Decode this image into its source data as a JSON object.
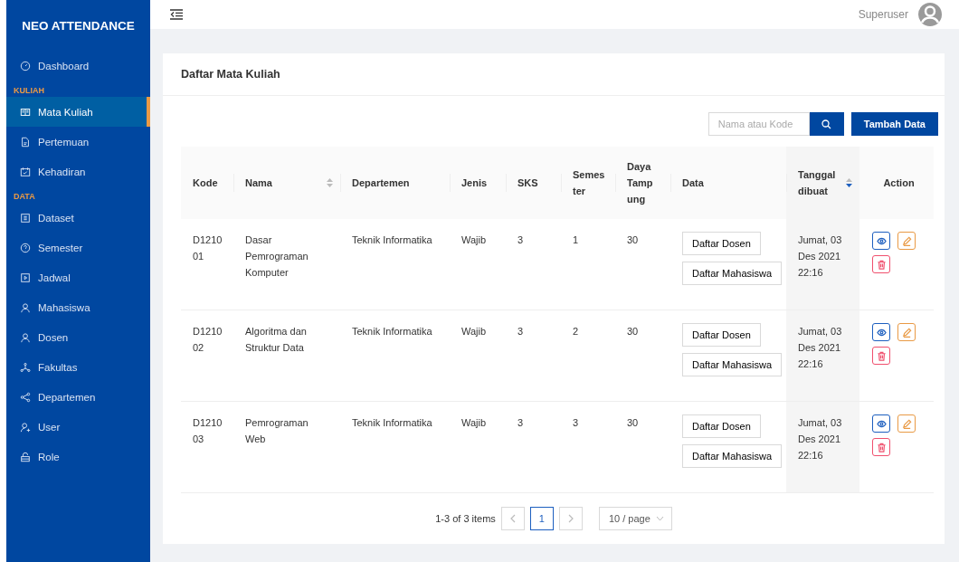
{
  "brand": "NEO ATTENDANCE",
  "nav": [
    {
      "kind": "item",
      "label": "Dashboard",
      "selected": false
    },
    {
      "kind": "section",
      "label": "KULIAH"
    },
    {
      "kind": "item",
      "label": "Mata Kuliah",
      "selected": true
    },
    {
      "kind": "item",
      "label": "Pertemuan",
      "selected": false
    },
    {
      "kind": "item",
      "label": "Kehadiran",
      "selected": false
    },
    {
      "kind": "section",
      "label": "DATA"
    },
    {
      "kind": "item",
      "label": "Dataset",
      "selected": false
    },
    {
      "kind": "item",
      "label": "Semester",
      "selected": false
    },
    {
      "kind": "item",
      "label": "Jadwal",
      "selected": false
    },
    {
      "kind": "item",
      "label": "Mahasiswa",
      "selected": false
    },
    {
      "kind": "item",
      "label": "Dosen",
      "selected": false
    },
    {
      "kind": "item",
      "label": "Fakultas",
      "selected": false
    },
    {
      "kind": "item",
      "label": "Departemen",
      "selected": false
    },
    {
      "kind": "item",
      "label": "User",
      "selected": false
    },
    {
      "kind": "item",
      "label": "Role",
      "selected": false
    }
  ],
  "header": {
    "user": "Superuser"
  },
  "card": {
    "title": "Daftar Mata Kuliah"
  },
  "search": {
    "placeholder": "Nama atau Kode"
  },
  "add_button": "Tambah Data",
  "table": {
    "columns": [
      {
        "label": "Kode"
      },
      {
        "label": "Nama",
        "sorted": false
      },
      {
        "label": "Departemen"
      },
      {
        "label": "Jenis"
      },
      {
        "label": "SKS"
      },
      {
        "label": "Semes ter"
      },
      {
        "label": "Daya Tamp ung"
      },
      {
        "label": "Data"
      },
      {
        "label": "Tanggal dibuat",
        "sorted": true
      },
      {
        "label": "Action"
      }
    ],
    "rows": [
      {
        "kode": "D1210 01",
        "nama": "Dasar Pemrograman Komputer",
        "departemen": "Teknik Informatika",
        "jenis": "Wajib",
        "sks": "3",
        "semester": "1",
        "daya_tampung": "30",
        "buttons": [
          "Daftar Dosen",
          "Daftar Mahasiswa"
        ],
        "tanggal": "Jumat, 03 Des 2021 22:16"
      },
      {
        "kode": "D1210 02",
        "nama": "Algoritma dan Struktur Data",
        "departemen": "Teknik Informatika",
        "jenis": "Wajib",
        "sks": "3",
        "semester": "2",
        "daya_tampung": "30",
        "buttons": [
          "Daftar Dosen",
          "Daftar Mahasiswa"
        ],
        "tanggal": "Jumat, 03 Des 2021 22:16"
      },
      {
        "kode": "D1210 03",
        "nama": "Pemrograman Web",
        "departemen": "Teknik Informatika",
        "jenis": "Wajib",
        "sks": "3",
        "semester": "3",
        "daya_tampung": "30",
        "buttons": [
          "Daftar Dosen",
          "Daftar Mahasiswa"
        ],
        "tanggal": "Jumat, 03 Des 2021 22:16"
      }
    ]
  },
  "pagination": {
    "summary": "1-3 of 3 items",
    "pages": [
      {
        "label": "1",
        "selected": true
      }
    ],
    "page_size": "10 / page"
  }
}
